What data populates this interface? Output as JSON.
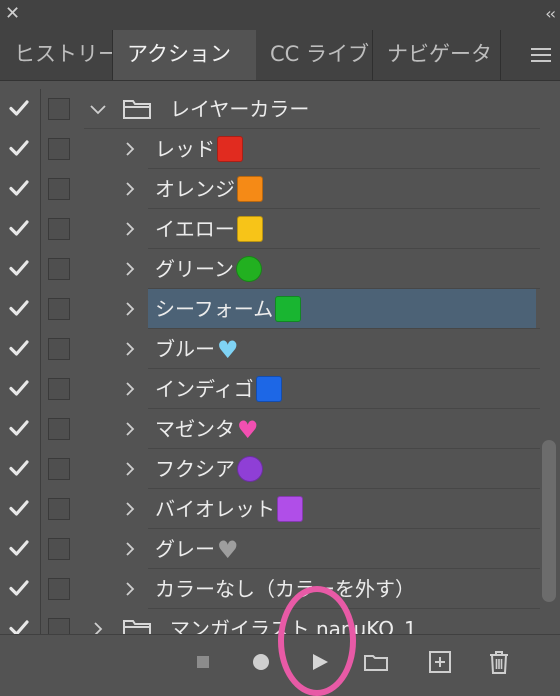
{
  "titlebar": {
    "close_icon": "close-icon",
    "collapse_icon": "collapse-panel-icon"
  },
  "tabs": [
    {
      "label": "ヒストリー"
    },
    {
      "label": "アクション",
      "active": true
    },
    {
      "label": "CC ライブ"
    },
    {
      "label": "ナビゲータ"
    }
  ],
  "actions": {
    "set_name": "レイヤーカラー",
    "items": [
      {
        "label": "レッド",
        "swatch": "square",
        "color": "#e12b1f"
      },
      {
        "label": "オレンジ",
        "swatch": "square",
        "color": "#f58a16"
      },
      {
        "label": "イエロー",
        "swatch": "square",
        "color": "#f7c418"
      },
      {
        "label": "グリーン",
        "swatch": "circle",
        "color": "#22b020"
      },
      {
        "label": "シーフォーム",
        "swatch": "square",
        "color": "#19b531",
        "selected": true
      },
      {
        "label": "ブルー",
        "swatch": "heart",
        "color": "#7fd3f5"
      },
      {
        "label": "インディゴ",
        "swatch": "square",
        "color": "#1d67e6"
      },
      {
        "label": "マゼンタ",
        "swatch": "heart",
        "color": "#f24fb1"
      },
      {
        "label": "フクシア",
        "swatch": "circle",
        "color": "#8f3fd6"
      },
      {
        "label": "バイオレット",
        "swatch": "square",
        "color": "#b04ee8"
      },
      {
        "label": "グレー",
        "swatch": "heart",
        "color": "#9e9e9e"
      },
      {
        "label": "カラーなし（カラーを外す）",
        "swatch": "none",
        "color": ""
      }
    ],
    "next_set_name": "マンガイラスト nanuKO_1"
  },
  "toolbar": {
    "stop": "stop-recording-icon",
    "record": "record-icon",
    "play": "play-selection-icon",
    "new_set": "create-new-set-icon",
    "new_action": "create-new-action-icon",
    "delete": "delete-icon"
  },
  "colors": {
    "panel_bg": "#535353",
    "tab_bar_bg": "#424242",
    "selection": "#4c6276",
    "annotation_circle": "#e85aa6"
  }
}
